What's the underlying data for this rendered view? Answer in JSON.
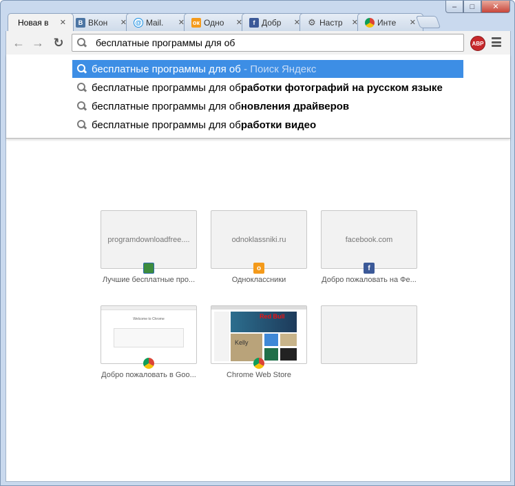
{
  "window": {
    "minimize": "‒",
    "maximize": "□",
    "close": "✕"
  },
  "tabs": [
    {
      "title": "Новая в",
      "icon": "none",
      "active": true
    },
    {
      "title": "ВКон",
      "icon": "vk-icon"
    },
    {
      "title": "Mail.",
      "icon": "mailru-icon"
    },
    {
      "title": "Одно",
      "icon": "odnoklassniki-icon"
    },
    {
      "title": "Добр",
      "icon": "facebook-icon"
    },
    {
      "title": "Настр",
      "icon": "gear-icon"
    },
    {
      "title": "Инте",
      "icon": "chrome-icon"
    }
  ],
  "tab_close": "✕",
  "toolbar": {
    "back": "←",
    "forward": "→",
    "reload": "↻",
    "abp": "ABP"
  },
  "omnibox": {
    "value": "бесплатные программы для об"
  },
  "suggestions": [
    {
      "typed": "бесплатные программы для об",
      "completion": "",
      "hint": " - Поиск Яндекс",
      "selected": true
    },
    {
      "typed": "бесплатные программы для об",
      "completion": "работки фотографий на русском языке",
      "hint": ""
    },
    {
      "typed": "бесплатные программы для об",
      "completion": "новления драйверов",
      "hint": ""
    },
    {
      "typed": "бесплатные программы для об",
      "completion": "работки видео",
      "hint": ""
    }
  ],
  "tiles": [
    {
      "thumb_text": "programdownloadfree....",
      "caption": "Лучшие бесплатные про...",
      "icon": "floppy-icon"
    },
    {
      "thumb_text": "odnoklassniki.ru",
      "caption": "Одноклассники",
      "icon": "odnoklassniki-icon"
    },
    {
      "thumb_text": "facebook.com",
      "caption": "Добро пожаловать на Фе...",
      "icon": "facebook-icon"
    },
    {
      "thumb_text": "",
      "caption": "Добро пожаловать в Goo...",
      "icon": "chrome-icon",
      "mini_text": "Welcome to Chrome"
    },
    {
      "thumb_text": "",
      "caption": "Chrome Web Store",
      "icon": "chrome-icon",
      "mini_text": "Kelly"
    },
    {
      "thumb_text": "",
      "caption": "",
      "icon": "none"
    }
  ],
  "colors": {
    "selected_suggestion": "#3d8ee5",
    "window_frame": "#c9d9ee",
    "abp": "#c7282b"
  }
}
